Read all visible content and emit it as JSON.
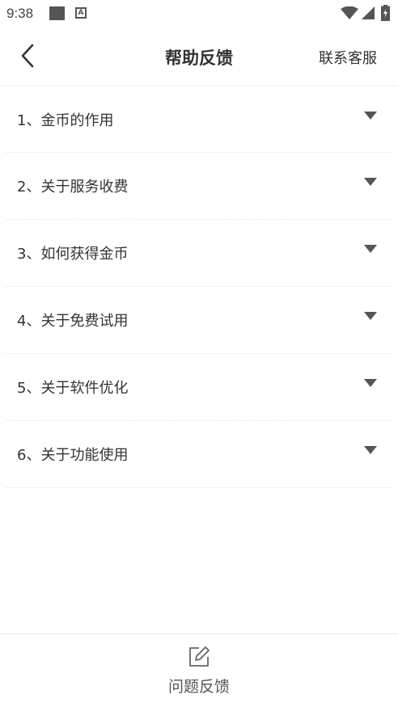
{
  "status_bar": {
    "time": "9:38",
    "icons": [
      "square-icon",
      "a-notification-icon",
      "wifi-icon",
      "signal-icon",
      "battery-icon"
    ]
  },
  "header": {
    "back_icon": "chevron-left-icon",
    "title": "帮助反馈",
    "contact_label": "联系客服"
  },
  "faq": {
    "items": [
      {
        "label": "1、金币的作用"
      },
      {
        "label": "2、关于服务收费"
      },
      {
        "label": "3、如何获得金币"
      },
      {
        "label": "4、关于免费试用"
      },
      {
        "label": "5、关于软件优化"
      },
      {
        "label": "6、关于功能使用"
      }
    ],
    "expand_icon": "caret-down-icon"
  },
  "bottom_bar": {
    "feedback_icon": "edit-icon",
    "feedback_label": "问题反馈"
  },
  "colors": {
    "text": "#333333",
    "divider": "#ececec",
    "icon": "#555555"
  }
}
